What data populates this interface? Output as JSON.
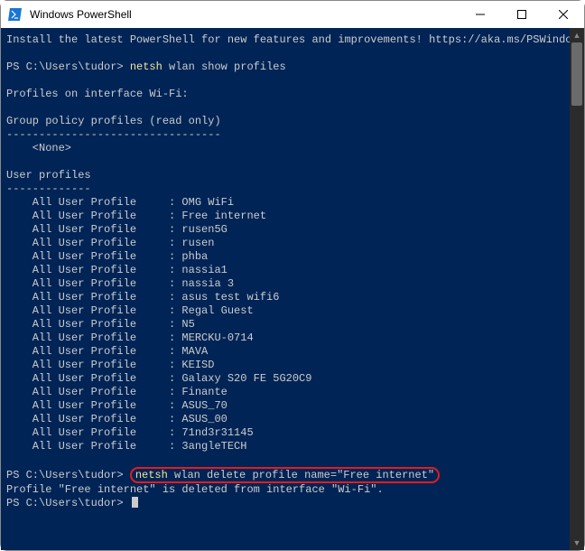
{
  "window": {
    "title": "Windows PowerShell"
  },
  "intro": {
    "line1": "Install the latest PowerShell for new features and improvements! https://aka.ms/PSWindows"
  },
  "cmd1": {
    "prompt": "PS C:\\Users\\tudor>",
    "tool": "netsh",
    "rest": " wlan show profiles"
  },
  "headers": {
    "interface": "Profiles on interface Wi-Fi:",
    "group_policy": "Group policy profiles (read only)",
    "dashes": "---------------------------------",
    "none": "    <None>",
    "user_profiles": "User profiles",
    "dashes2": "-------------"
  },
  "profiles": [
    "OMG WiFi",
    "Free internet",
    "rusen5G",
    "rusen",
    "phba",
    "nassia1",
    "nassia 3",
    "asus test wifi6",
    "Regal Guest",
    "N5",
    "MERCKU-0714",
    "MAVA",
    "KEISD",
    "Galaxy S20 FE 5G20C9",
    "Finante",
    "ASUS_70",
    "ASUS_00",
    "71nd3r31145",
    "3angleTECH"
  ],
  "profile_label": "    All User Profile     : ",
  "cmd2": {
    "prompt": "PS C:\\Users\\tudor>",
    "tool": "netsh",
    "rest": " wlan delete profile name=\"Free internet\""
  },
  "result": "Profile \"Free internet\" is deleted from interface \"Wi-Fi\".",
  "cmd3": {
    "prompt": "PS C:\\Users\\tudor>"
  }
}
